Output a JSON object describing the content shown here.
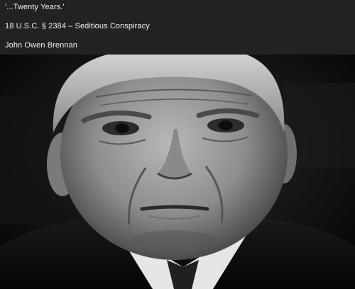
{
  "caption": {
    "lines": [
      "'...Twenty Years.'",
      "18 U.S.C. § 2384 – Seditious Conspiracy",
      "John Owen Brennan"
    ]
  },
  "photo": {
    "description_icon": "portrait-photo"
  },
  "colors": {
    "background": "#222222",
    "text": "#f2f2f2"
  }
}
